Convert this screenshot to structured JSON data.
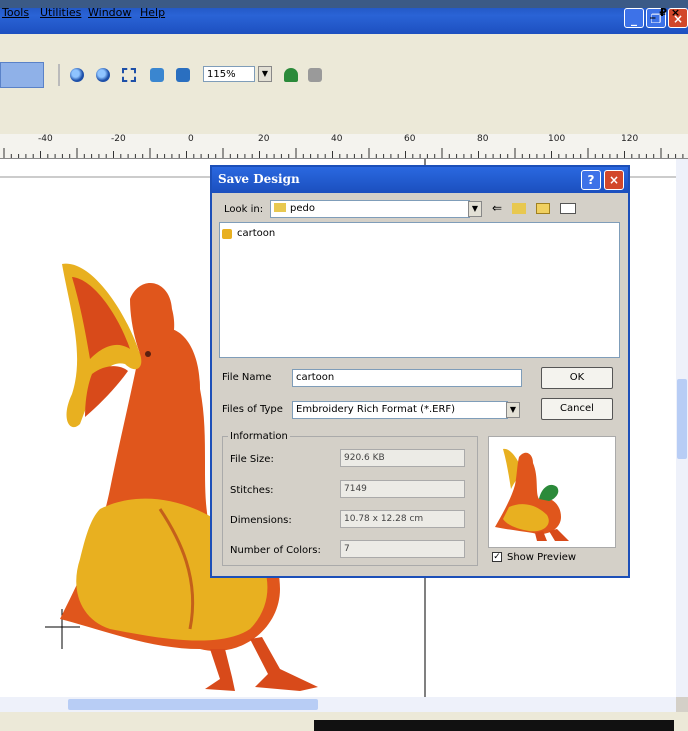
{
  "menu": {
    "items": [
      "Tools",
      "Utilities",
      "Window",
      "Help"
    ],
    "right_controls": "_ ₽ ×"
  },
  "toolbar": {
    "zoom_value": "115%",
    "icons": [
      "zoom-in-icon",
      "zoom-out-icon",
      "zoom-box-icon",
      "fit-page-icon",
      "fit-design-icon",
      "zoom-dropdown-icon",
      "flag-icon",
      "lock-icon"
    ]
  },
  "ruler": {
    "labels": [
      "-40",
      "-20",
      "0",
      "20",
      "40",
      "60",
      "80",
      "100",
      "120"
    ]
  },
  "dialog": {
    "title": "Save Design",
    "help_label": "?",
    "close_label": "×",
    "look_in_label": "Look in:",
    "look_in_value": "pedo",
    "file_items": [
      "cartoon"
    ],
    "file_name_label": "File Name",
    "file_name_value": "cartoon",
    "file_type_label": "Files of Type",
    "file_type_value": "Embroidery Rich Format (*.ERF)",
    "ok_label": "OK",
    "cancel_label": "Cancel",
    "info": {
      "group_label": "Information",
      "file_size_label": "File Size:",
      "file_size_value": "920.6 KB",
      "stitches_label": "Stitches:",
      "stitches_value": "7149",
      "dimensions_label": "Dimensions:",
      "dimensions_value": "10.78 x 12.28 cm",
      "colors_label": "Number of Colors:",
      "colors_value": "7"
    },
    "show_preview_label": "Show Preview",
    "show_preview_checked": true
  },
  "colors": {
    "titlebar": "#2a63d6",
    "embroidery_orange": "#e0561c",
    "embroidery_yellow": "#e8b020"
  }
}
